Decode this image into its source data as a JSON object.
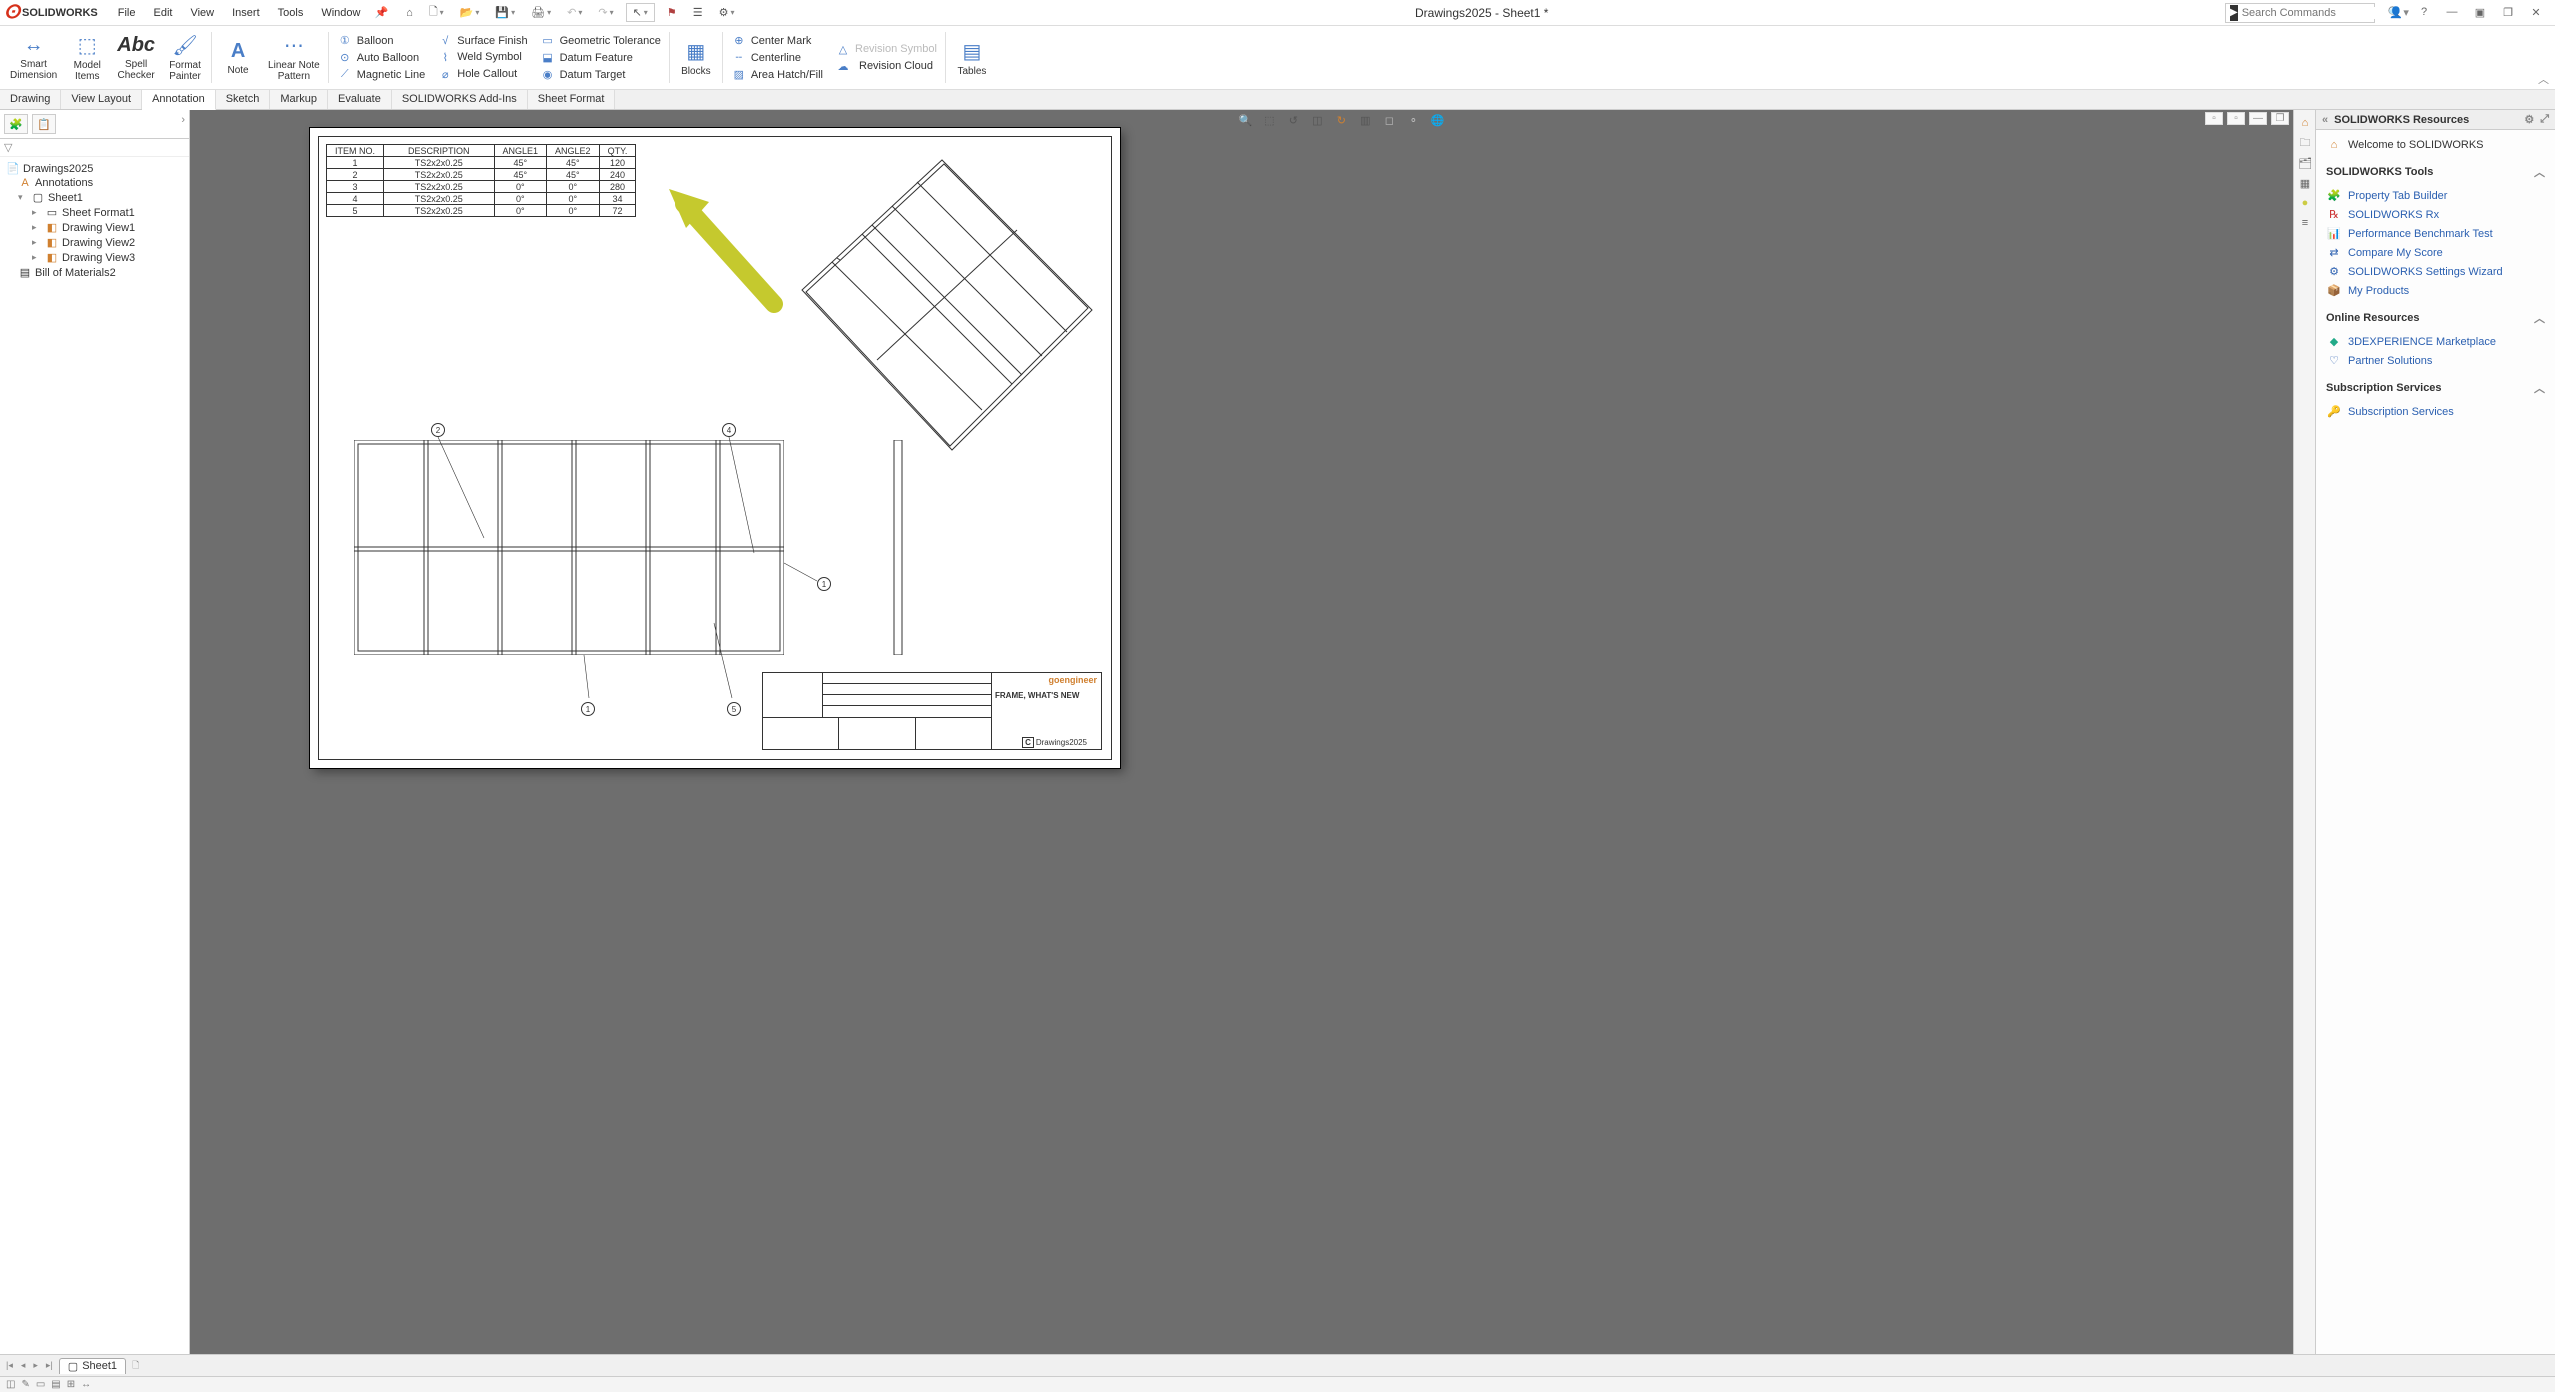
{
  "app": {
    "name": "SOLIDWORKS",
    "doc_title": "Drawings2025 - Sheet1 *"
  },
  "menu": {
    "file": "File",
    "edit": "Edit",
    "view": "View",
    "insert": "Insert",
    "tools": "Tools",
    "window": "Window"
  },
  "search": {
    "placeholder": "Search Commands"
  },
  "ribbon": {
    "big": {
      "smart_dimension": "Smart\nDimension",
      "model_items": "Model\nItems",
      "spell_checker": "Spell\nChecker",
      "format_painter": "Format\nPainter",
      "note": "Note",
      "linear_note_pattern": "Linear Note\nPattern",
      "blocks": "Blocks",
      "tables": "Tables"
    },
    "col1": {
      "balloon": "Balloon",
      "auto_balloon": "Auto Balloon",
      "magnetic_line": "Magnetic Line"
    },
    "col2": {
      "surface_finish": "Surface Finish",
      "weld_symbol": "Weld Symbol",
      "hole_callout": "Hole Callout"
    },
    "col3": {
      "geometric_tolerance": "Geometric Tolerance",
      "datum_feature": "Datum Feature",
      "datum_target": "Datum Target"
    },
    "col4": {
      "center_mark": "Center Mark",
      "centerline": "Centerline",
      "area_hatch": "Area Hatch/Fill"
    },
    "col5": {
      "revision_symbol": "Revision Symbol",
      "revision_cloud": "Revision Cloud"
    }
  },
  "ribbon_tabs": {
    "drawing": "Drawing",
    "view_layout": "View Layout",
    "annotation": "Annotation",
    "sketch": "Sketch",
    "markup": "Markup",
    "evaluate": "Evaluate",
    "addins": "SOLIDWORKS Add-Ins",
    "sheet_format": "Sheet Format"
  },
  "tree": {
    "root": "Drawings2025",
    "annotations": "Annotations",
    "sheet1": "Sheet1",
    "sheet_format1": "Sheet Format1",
    "view1": "Drawing View1",
    "view2": "Drawing View2",
    "view3": "Drawing View3",
    "bom": "Bill of Materials2"
  },
  "bom_table": {
    "headers": {
      "item": "ITEM NO.",
      "desc": "DESCRIPTION",
      "a1": "ANGLE1",
      "a2": "ANGLE2",
      "qty": "QTY."
    },
    "rows": [
      {
        "item": "1",
        "desc": "TS2x2x0.25",
        "a1": "45°",
        "a2": "45°",
        "qty": "120"
      },
      {
        "item": "2",
        "desc": "TS2x2x0.25",
        "a1": "45°",
        "a2": "45°",
        "qty": "240"
      },
      {
        "item": "3",
        "desc": "TS2x2x0.25",
        "a1": "0°",
        "a2": "0°",
        "qty": "280"
      },
      {
        "item": "4",
        "desc": "TS2x2x0.25",
        "a1": "0°",
        "a2": "0°",
        "qty": "34"
      },
      {
        "item": "5",
        "desc": "TS2x2x0.25",
        "a1": "0°",
        "a2": "0°",
        "qty": "72"
      }
    ]
  },
  "titleblock": {
    "title": "FRAME, WHAT'S NEW",
    "dwg": "Drawings2025",
    "brand": "goengineer"
  },
  "balloons": {
    "b1": "1",
    "b2": "1",
    "b3": "2",
    "b4": "4",
    "b5": "5"
  },
  "right": {
    "title": "SOLIDWORKS Resources",
    "welcome": "Welcome to SOLIDWORKS",
    "tools_hdr": "SOLIDWORKS Tools",
    "ptb": "Property Tab Builder",
    "rx": "SOLIDWORKS Rx",
    "perf": "Performance Benchmark Test",
    "compare": "Compare My Score",
    "wizard": "SOLIDWORKS Settings Wizard",
    "products": "My Products",
    "online_hdr": "Online Resources",
    "marketplace": "3DEXPERIENCE Marketplace",
    "partner": "Partner Solutions",
    "sub_hdr": "Subscription Services",
    "sub": "Subscription Services"
  },
  "sheet_tab": {
    "name": "Sheet1"
  }
}
